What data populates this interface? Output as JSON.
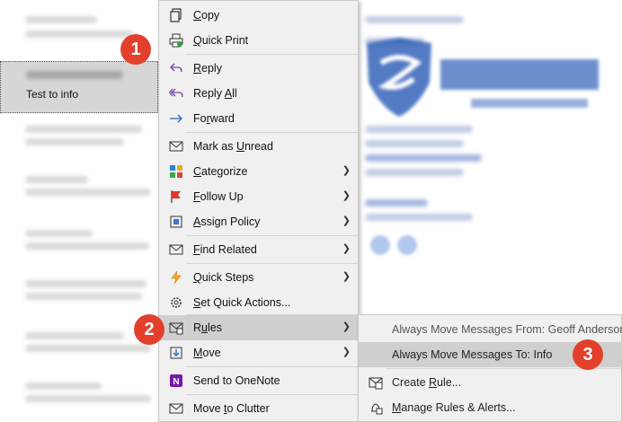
{
  "message_list": {
    "selected_item": {
      "subject": "Test to info"
    }
  },
  "context_menu": {
    "items": [
      {
        "label": "Copy",
        "icon": "copy-icon",
        "key_index": 0
      },
      {
        "label": "Quick Print",
        "icon": "print-icon",
        "key_index": 0
      },
      {
        "label": "Reply",
        "icon": "reply-icon",
        "key_index": 0
      },
      {
        "label": "Reply All",
        "icon": "reply-all-icon",
        "key_index": 6
      },
      {
        "label": "Forward",
        "icon": "forward-icon",
        "key_index": 2
      },
      {
        "label": "Mark as Unread",
        "icon": "envelope-icon",
        "key_index": 8
      },
      {
        "label": "Categorize",
        "icon": "categorize-icon",
        "key_index": 0,
        "submenu": true
      },
      {
        "label": "Follow Up",
        "icon": "flag-icon",
        "key_index": 0,
        "submenu": true
      },
      {
        "label": "Assign Policy",
        "icon": "policy-icon",
        "key_index": 0,
        "submenu": true
      },
      {
        "label": "Find Related",
        "icon": "find-related-icon",
        "key_index": 0,
        "submenu": true
      },
      {
        "label": "Quick Steps",
        "icon": "lightning-icon",
        "key_index": 0,
        "submenu": true
      },
      {
        "label": "Set Quick Actions...",
        "icon": "gear-icon",
        "key_index": 0
      },
      {
        "label": "Rules",
        "icon": "rules-icon",
        "key_index": 1,
        "submenu": true,
        "highlighted": true
      },
      {
        "label": "Move",
        "icon": "move-icon",
        "key_index": 0,
        "submenu": true
      },
      {
        "label": "Send to OneNote",
        "icon": "onenote-icon",
        "key_index": -1
      },
      {
        "label": "Move to Clutter",
        "icon": "clutter-icon",
        "key_index": 5
      }
    ]
  },
  "rules_submenu": {
    "items": [
      {
        "label": "Always Move Messages From: Geoff Anderson",
        "dim": true
      },
      {
        "label": "Always Move Messages To: Info",
        "highlighted": true
      },
      {
        "label": "Create Rule...",
        "icon": "create-rule-icon",
        "key_index": 7
      },
      {
        "label": "Manage Rules & Alerts...",
        "icon": "manage-rules-icon",
        "key_index": 0
      }
    ]
  },
  "callouts": [
    "1",
    "2",
    "3"
  ],
  "colors": {
    "callout": "#e2402c",
    "menu_bg": "#f0f0f0",
    "highlight": "#cfcfcf",
    "logo_blue": "#1a4fb0"
  }
}
